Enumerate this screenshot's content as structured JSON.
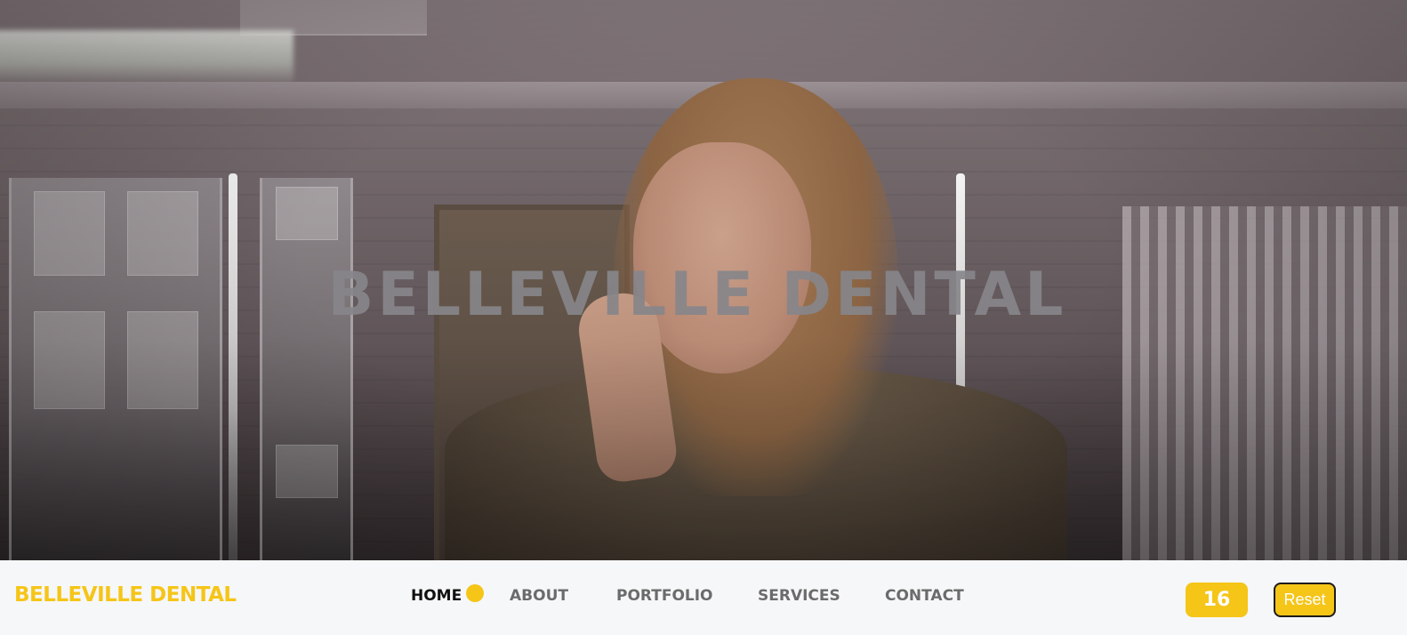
{
  "hero": {
    "title": "BELLEVILLE DENTAL",
    "overlay_title_color": "#87858a"
  },
  "navbar": {
    "brand": "BELLEVILLE DENTAL",
    "brand_color": "#f5c518",
    "items": [
      {
        "label": "HOME",
        "active": true
      },
      {
        "label": "ABOUT",
        "active": false
      },
      {
        "label": "PORTFOLIO",
        "active": false
      },
      {
        "label": "SERVICES",
        "active": false
      },
      {
        "label": "CONTACT",
        "active": false
      }
    ],
    "active_indicator_icon": "dot-indicator-icon",
    "counter": "16",
    "reset_label": "Reset",
    "accent_color": "#f5c518"
  }
}
